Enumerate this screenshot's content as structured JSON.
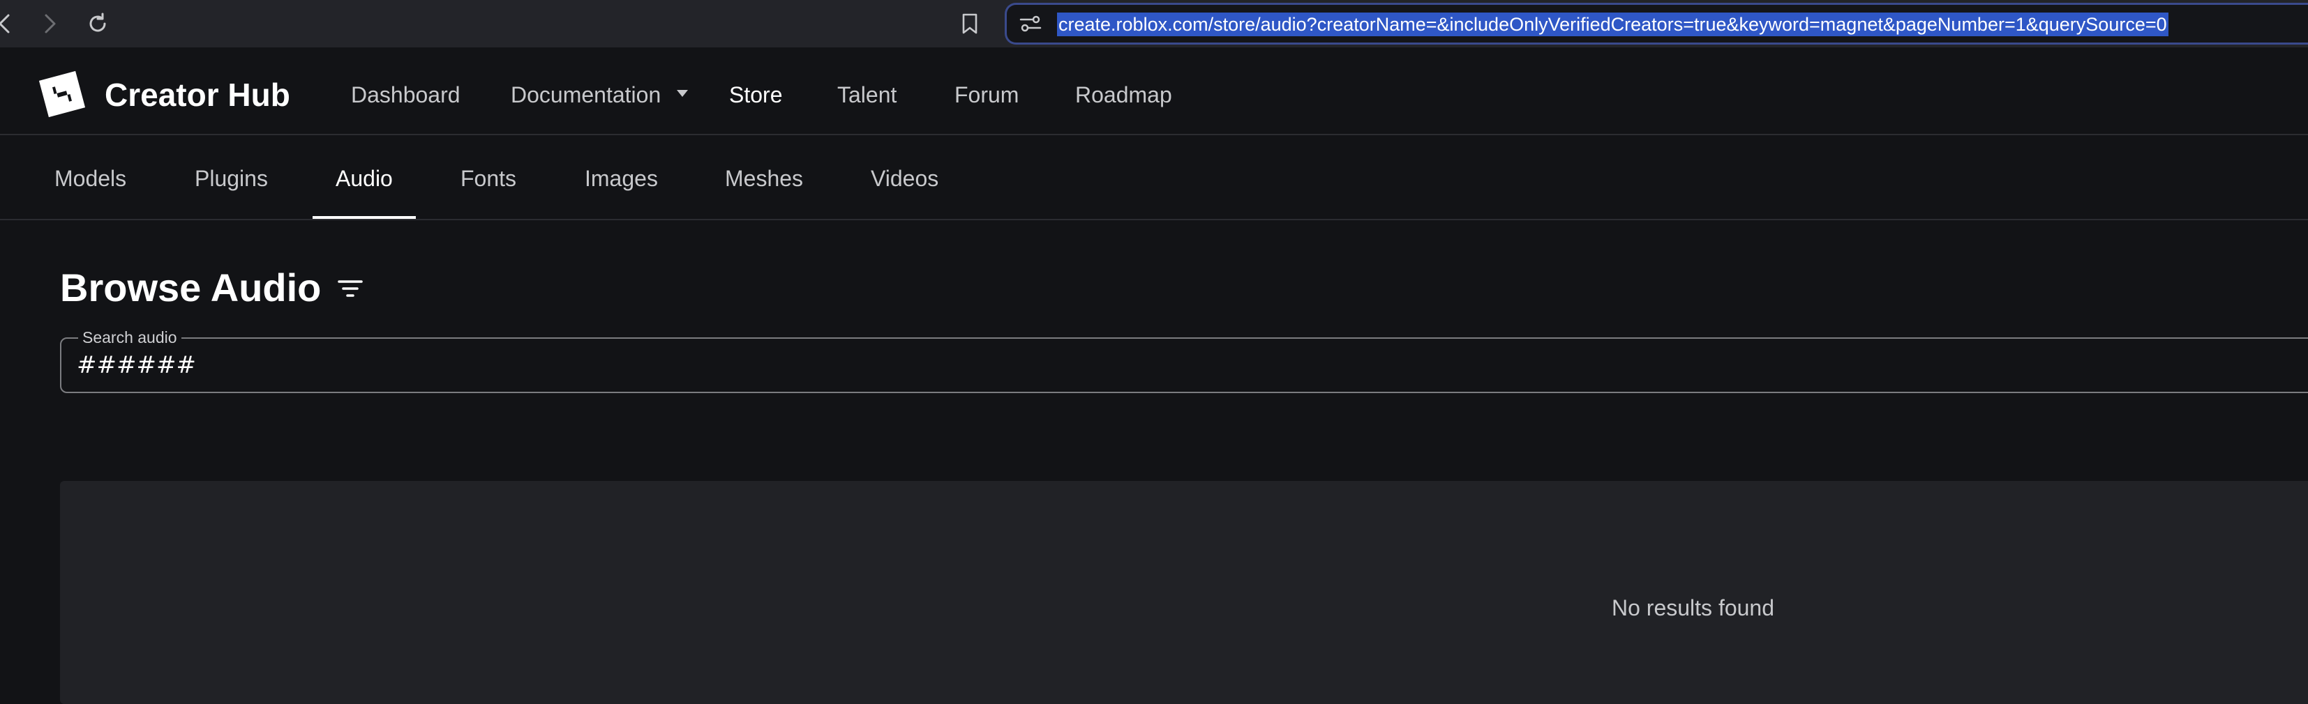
{
  "browser": {
    "url": "create.roblox.com/store/audio?creatorName=&includeOnlyVerifiedCreators=true&keyword=magnet&pageNumber=1&querySource=0",
    "icons": [
      "back-icon",
      "forward-icon",
      "reload-icon",
      "bookmark-icon",
      "site-info-icon"
    ]
  },
  "header": {
    "logo_text": "Creator Hub",
    "nav": {
      "dashboard": "Dashboard",
      "documentation": "Documentation",
      "store": "Store",
      "talent": "Talent",
      "forum": "Forum",
      "roadmap": "Roadmap"
    },
    "active": "Store"
  },
  "sub_nav": {
    "tabs": [
      "Models",
      "Plugins",
      "Audio",
      "Fonts",
      "Images",
      "Meshes",
      "Videos"
    ],
    "active": "Audio"
  },
  "main": {
    "title": "Browse Audio",
    "search": {
      "label": "Search audio",
      "value": "######"
    },
    "empty_state": "No results found"
  },
  "colors": {
    "background": "#121316",
    "panel": "#212226",
    "url_highlight": "#2f57c6",
    "address_border": "#3a4a8c"
  }
}
